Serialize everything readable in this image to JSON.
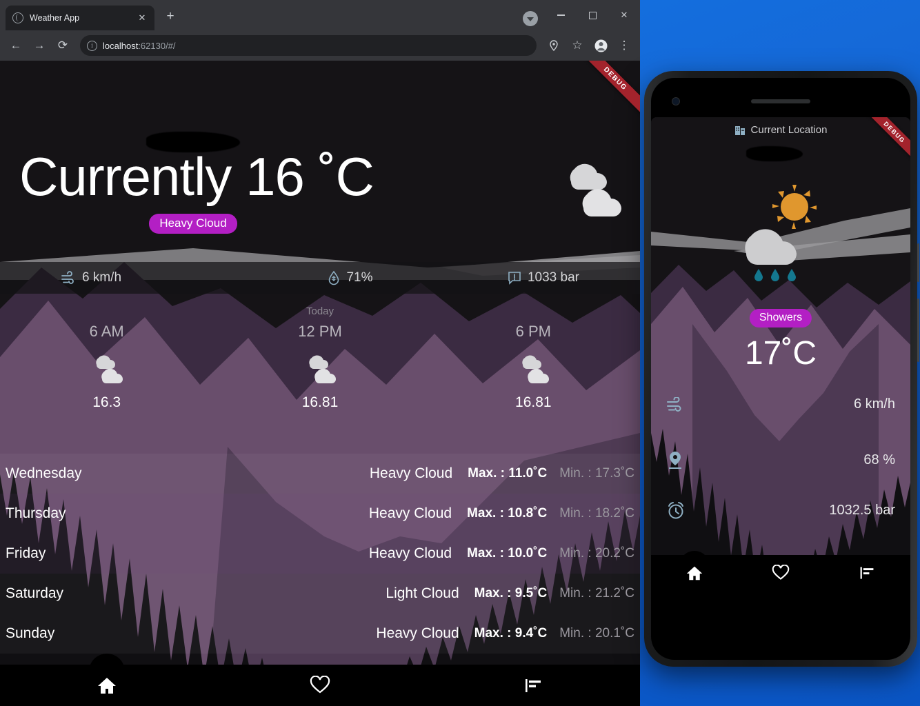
{
  "browser": {
    "tab": {
      "title": "Weather App",
      "favicon": "globe-icon",
      "close": "✕"
    },
    "new_tab": "+",
    "window_controls": {
      "minimize": "—",
      "maximize": "□",
      "close": "✕"
    },
    "toolbar": {
      "back": "←",
      "forward": "→",
      "reload": "⟳",
      "info": "i",
      "url_host": "localhost",
      "url_rest": ":62130/#/",
      "location_icon": "location-pin-icon",
      "bookmark_icon": "☆",
      "profile_icon": "person-icon",
      "menu_icon": "⋮"
    }
  },
  "app": {
    "ribbon": "DEBUG",
    "hero": {
      "title": "Currently 16 ˚C",
      "condition": "Heavy Cloud"
    },
    "stats": [
      {
        "icon": "wind-icon",
        "value": "6 km/h"
      },
      {
        "icon": "humidity-drop-icon",
        "value": "71%"
      },
      {
        "icon": "pressure-icon",
        "value": "1033 bar"
      }
    ],
    "hourly": {
      "today_label": "Today",
      "items": [
        {
          "time": "6 AM",
          "icon": "heavy-cloud-icon",
          "temp": "16.3"
        },
        {
          "time": "12 PM",
          "icon": "heavy-cloud-icon",
          "temp": "16.81"
        },
        {
          "time": "6 PM",
          "icon": "heavy-cloud-icon",
          "temp": "16.81"
        }
      ]
    },
    "forecast": [
      {
        "day": "Wednesday",
        "desc": "Heavy Cloud",
        "max": "Max. : 11.0˚C",
        "min": "Min. : 17.3˚C"
      },
      {
        "day": "Thursday",
        "desc": "Heavy Cloud",
        "max": "Max. : 10.8˚C",
        "min": "Min. : 18.2˚C"
      },
      {
        "day": "Friday",
        "desc": "Heavy Cloud",
        "max": "Max. : 10.0˚C",
        "min": "Min. : 20.2˚C"
      },
      {
        "day": "Saturday",
        "desc": "Light Cloud",
        "max": "Max. : 9.5˚C",
        "min": "Min. : 21.2˚C"
      },
      {
        "day": "Sunday",
        "desc": "Heavy Cloud",
        "max": "Max. : 9.4˚C",
        "min": "Min. : 20.1˚C"
      }
    ],
    "nav": [
      {
        "icon": "home-icon",
        "active": true
      },
      {
        "icon": "heart-icon",
        "active": false
      },
      {
        "icon": "chart-bars-icon",
        "active": false
      }
    ]
  },
  "phone": {
    "ribbon": "DEBUG",
    "location": {
      "icon": "building-icon",
      "label": "Current Location"
    },
    "condition": "Showers",
    "temperature": "17˚C",
    "stats": [
      {
        "icon": "wind-icon",
        "value": "6 km/h"
      },
      {
        "icon": "location-pin-icon",
        "value": "68 %"
      },
      {
        "icon": "alarm-clock-icon",
        "value": "1032.5 bar"
      }
    ],
    "nav": [
      {
        "icon": "home-icon",
        "active": true
      },
      {
        "icon": "heart-icon",
        "active": false
      },
      {
        "icon": "chart-bars-icon",
        "active": false
      }
    ]
  },
  "colors": {
    "accent_chip": "#b31fc4",
    "ribbon": "#a3232c",
    "mountain_light": "#6e5170",
    "mountain_dark": "#3b2b42",
    "sun": "#e0972e",
    "rain": "#14788f",
    "cloud": "#d6d6d8",
    "icon_blue": "#8fb0c4",
    "desktop_blue": "#1277e8"
  }
}
